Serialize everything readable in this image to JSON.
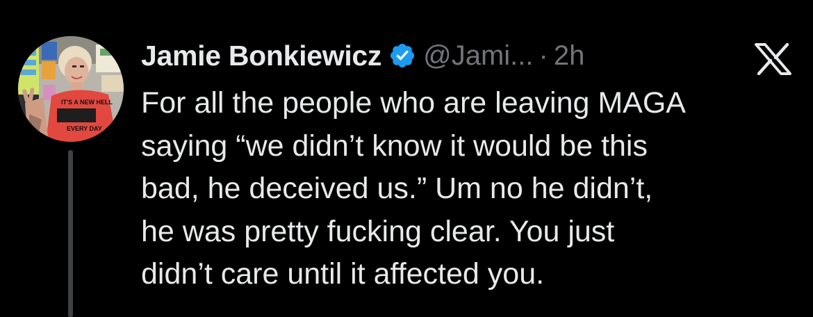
{
  "author": {
    "display_name": "Jamie Bonkiewicz",
    "handle": "@Jami...",
    "separator": "·",
    "timestamp": "2h",
    "verified": true,
    "avatar_shirt_text_top": "IT'S A NEW HELL",
    "avatar_shirt_text_bottom": "EVERY DAY"
  },
  "tweet": {
    "text": "For all the people who are leaving MAGA\nsaying “we didn’t know it would be this\nbad, he deceived us.” Um no he didn’t,\nhe was pretty fucking clear. You just\ndidn’t care until it affected you."
  },
  "icons": {
    "verified": "verified-badge-icon",
    "platform": "x-logo-icon"
  },
  "colors": {
    "background": "#000000",
    "text_primary": "#e7e9ea",
    "text_secondary": "#71767b",
    "verified_blue": "#1d9bf0",
    "thread_line": "#3e4144"
  }
}
